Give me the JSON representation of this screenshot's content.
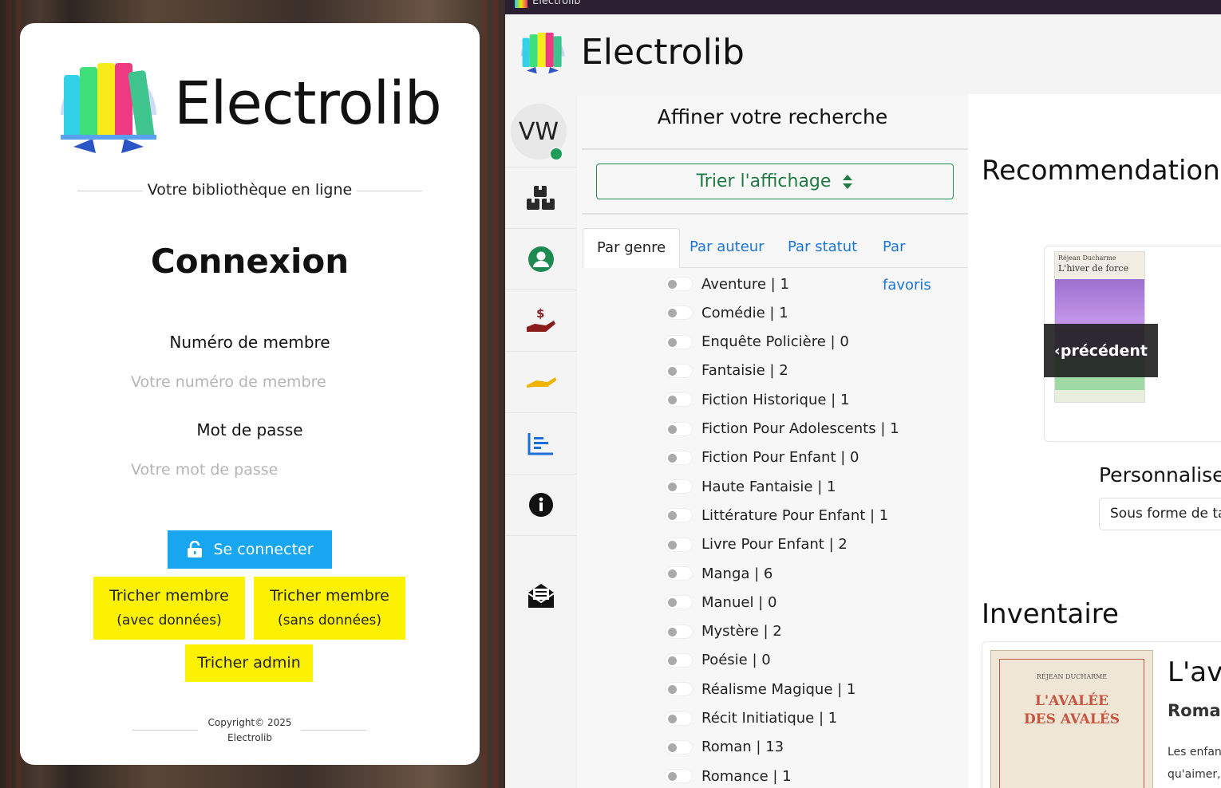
{
  "login": {
    "brand": "Electrolib",
    "tagline": "Votre bibliothèque en ligne",
    "title": "Connexion",
    "member_label": "Numéro de membre",
    "member_placeholder": "Votre numéro de membre",
    "password_label": "Mot de passe",
    "password_placeholder": "Votre mot de passe",
    "connect_button": "Se connecter",
    "cheat_member_with_1": "Tricher membre",
    "cheat_member_with_2": "(avec données)",
    "cheat_member_without_1": "Tricher membre",
    "cheat_member_without_2": "(sans données)",
    "cheat_admin": "Tricher admin",
    "copyright_line1": "Copyright© 2025",
    "copyright_line2": "Electrolib"
  },
  "window": {
    "title": "Electrolib",
    "brand": "Electrolib"
  },
  "sidebar": {
    "avatar_initials": "VW",
    "items": [
      {
        "icon": "boxes-icon",
        "color": "#2a2a2a"
      },
      {
        "icon": "user-circle-icon",
        "color": "#1d8a52"
      },
      {
        "icon": "hand-dollar-icon",
        "color": "#8a1c1c"
      },
      {
        "icon": "hand-holding-icon",
        "color": "#f0b400"
      },
      {
        "icon": "chart-icon",
        "color": "#1c6fd8"
      },
      {
        "icon": "info-icon",
        "color": "#111111"
      },
      {
        "icon": "envelope-open-icon",
        "color": "#111111"
      }
    ]
  },
  "filters": {
    "title": "Affiner votre recherche",
    "sort_button": "Trier l'affichage",
    "tabs": [
      "Par genre",
      "Par auteur",
      "Par statut",
      "Par favoris"
    ],
    "active_tab": "Par genre",
    "genres": [
      "Aventure | 1",
      "Comédie | 1",
      "Enquête Policière | 0",
      "Fantaisie | 2",
      "Fiction Historique | 1",
      "Fiction Pour Adolescents | 1",
      "Fiction Pour Enfant | 0",
      "Haute Fantaisie | 1",
      "Littérature Pour Enfant | 1",
      "Livre Pour Enfant | 2",
      "Manga | 6",
      "Manuel | 0",
      "Mystère | 2",
      "Poésie | 0",
      "Réalisme Magique | 1",
      "Récit Initiatique | 1",
      "Roman | 13",
      "Romance | 1"
    ]
  },
  "main": {
    "recommendations_title": "Recommendations",
    "rec_book_author": "Réjean Ducharme",
    "rec_book_title": "L'hiver de force",
    "prev_button": "‹précédent",
    "personalise_title": "Personnalise",
    "display_select": "Sous forme de ta",
    "inventory_title": "Inventaire",
    "inv_book_cover_author": "RÉJEAN DUCHARME",
    "inv_book_cover_title_1": "L'AVALÉE",
    "inv_book_cover_title_2": "DES AVALÉS",
    "inv_book_title": "L'ava",
    "inv_book_genre": "Roman",
    "inv_desc_1": "Les enfan",
    "inv_desc_2": "qu'aimer,"
  },
  "colors": {
    "connect_blue": "#17a6ef",
    "cheat_yellow": "#fbf100",
    "link_blue": "#1c75d8",
    "sort_green": "#1f7a43",
    "online_green": "#1d9d59"
  }
}
